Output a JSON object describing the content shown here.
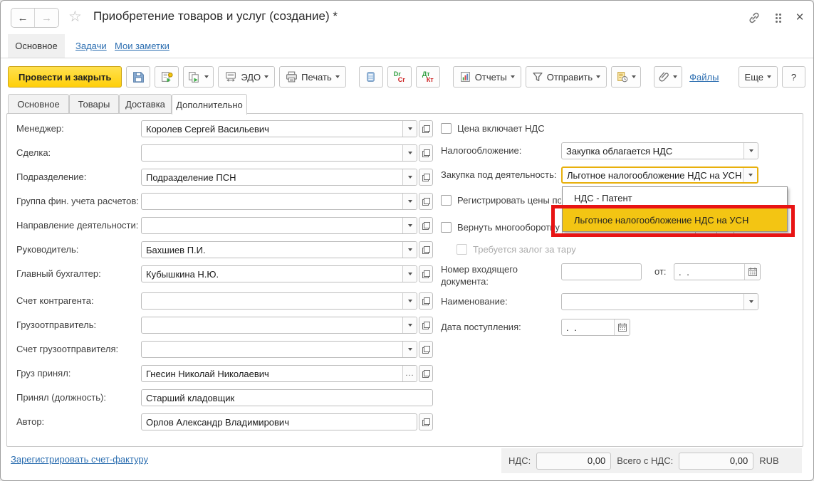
{
  "titlebar": {
    "title": "Приобретение товаров и услуг (создание) *",
    "back_glyph": "←",
    "forward_glyph": "→",
    "star_glyph": "☆",
    "close_glyph": "×"
  },
  "nav_tabs": {
    "main": "Основное",
    "tasks": "Задачи",
    "notes": "Мои заметки"
  },
  "toolbar": {
    "post_close": "Провести и закрыть",
    "edo": "ЭДО",
    "print": "Печать",
    "reports": "Отчеты",
    "send": "Отправить",
    "files": "Файлы",
    "more": "Еще",
    "help": "?",
    "drcr": {
      "dr": "Dr",
      "cr": "Cr"
    },
    "dtkt": {
      "dt": "Дт",
      "kt": "Кт"
    }
  },
  "doc_tabs": {
    "main": "Основное",
    "goods": "Товары",
    "delivery": "Доставка",
    "additional": "Дополнительно"
  },
  "fields": {
    "manager": {
      "label": "Менеджер:",
      "value": "Королев Сергей Васильевич"
    },
    "deal": {
      "label": "Сделка:",
      "value": ""
    },
    "department": {
      "label": "Подразделение:",
      "value": "Подразделение ПСН"
    },
    "fin_group": {
      "label": "Группа фин. учета расчетов:",
      "value": ""
    },
    "activity": {
      "label": "Направление деятельности:",
      "value": ""
    },
    "head": {
      "label": "Руководитель:",
      "value": "Бахшиев П.И."
    },
    "chief_accountant": {
      "label": "Главный бухгалтер:",
      "value": "Кубышкина Н.Ю."
    },
    "counterparty_acc": {
      "label": "Счет контрагента:",
      "value": ""
    },
    "consignor": {
      "label": "Грузоотправитель:",
      "value": ""
    },
    "consignor_acc": {
      "label": "Счет грузоотправителя:",
      "value": ""
    },
    "cargo_accepted": {
      "label": "Груз принял:",
      "value": "Гнесин Николай Николаевич"
    },
    "accepted_position": {
      "label": "Принял (должность):",
      "value": "Старший кладовщик"
    },
    "author": {
      "label": "Автор:",
      "value": "Орлов Александр Владимирович"
    }
  },
  "right": {
    "price_incl_vat_label": "Цена включает НДС",
    "taxation_label": "Налогообложение:",
    "taxation_value": "Закупка облагается НДС",
    "purchase_activity_label": "Закупка под деятельность:",
    "purchase_activity_value": "Льготное налогообложение НДС на УСН",
    "dropdown": {
      "items": [
        {
          "label": "НДС - Патент"
        },
        {
          "label": "Льготное налогообложение НДС на УСН",
          "highlighted": true
        }
      ],
      "highlight_color": "#f3c513",
      "annotation_color": "#e81414"
    },
    "register_prices_label": "Регистрировать цены по",
    "return_packaging_label": "Вернуть многооборотну",
    "deposit_required_label": "Требуется залог за тару",
    "incoming_number_label": "Номер входящего документа:",
    "incoming_number_line1": "Номер входящего",
    "incoming_number_line2": "документа:",
    "incoming_number_value": "",
    "from_label": "от:",
    "date_placeholder": ".  .",
    "name_label": "Наименование:",
    "name_value": "",
    "receipt_date_label": "Дата поступления:"
  },
  "footer": {
    "register_invoice": "Зарегистрировать счет-фактуру",
    "vat_label": "НДС:",
    "vat_value": "0,00",
    "total_label": "Всего с НДС:",
    "total_value": "0,00",
    "currency": "RUB"
  },
  "misc": {
    "ellipsis_glyph": "..."
  }
}
